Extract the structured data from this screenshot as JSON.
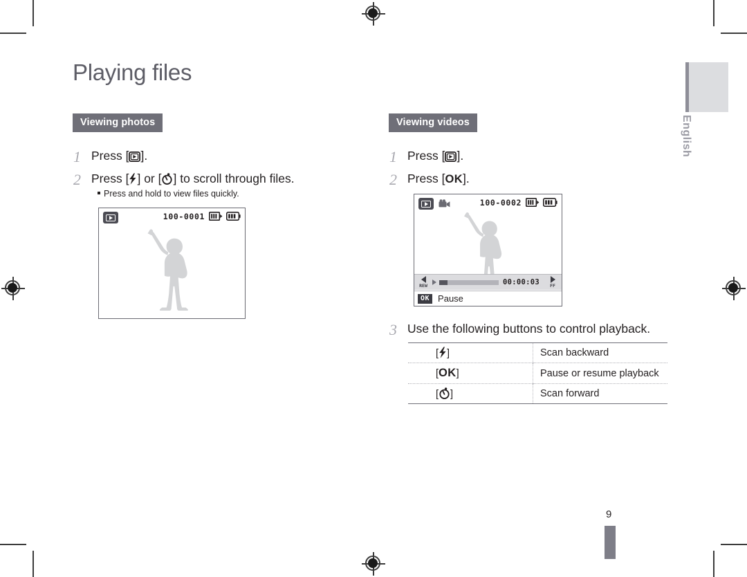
{
  "document": {
    "title": "Playing files",
    "page_number": "9",
    "language_tab": "English"
  },
  "sections": [
    {
      "heading": "Viewing photos",
      "steps": [
        {
          "num": "1",
          "text_before": "Press [",
          "key": "play-icon",
          "text_after": "]."
        },
        {
          "num": "2",
          "text_before": "Press [",
          "key": "flash-icon",
          "text_mid": "] or [",
          "key2": "timer-icon",
          "text_after": "] to scroll through files."
        }
      ],
      "bullet": "Press and hold to view files quickly.",
      "screen": {
        "type": "photo-preview",
        "file_number": "100-0001",
        "icons": [
          "playback-mode-icon",
          "memory-card-icon",
          "battery-icon"
        ]
      }
    },
    {
      "heading": "Viewing videos",
      "steps": [
        {
          "num": "1",
          "text_before": "Press [",
          "key": "play-icon",
          "text_after": "]."
        },
        {
          "num": "2",
          "text_before": "Press [",
          "key": "ok-key",
          "key_label": "OK",
          "text_after": "]."
        },
        {
          "num": "3",
          "text": "Use the following buttons to control playback."
        }
      ],
      "screen": {
        "type": "video-preview",
        "file_number": "100-0002",
        "icons": [
          "playback-mode-icon",
          "movie-icon",
          "memory-card-icon",
          "battery-icon"
        ],
        "rew_label": "REW",
        "ff_label": "FF",
        "timecode": "00:00:03",
        "ok_chip": "OK",
        "status_label": "Pause"
      },
      "control_table": {
        "rows": [
          {
            "key_icon": "flash-icon",
            "key_open": "[",
            "key_close": "]",
            "description": "Scan backward"
          },
          {
            "key_icon": "ok-key",
            "key_label": "OK",
            "key_open": "[",
            "key_close": "]",
            "description": "Pause or resume playback"
          },
          {
            "key_icon": "timer-icon",
            "key_open": "[",
            "key_close": "]",
            "description": "Scan forward"
          }
        ]
      }
    }
  ],
  "colors": {
    "heading_bg": "#6f6f78",
    "title_text": "#5d5d66",
    "step_num": "#a9a9b0",
    "body_text": "#231f20",
    "lang_tab_bg": "#dcdde0",
    "lang_tab_text": "#9b9ba4",
    "silhouette": "#d3d4d6"
  }
}
